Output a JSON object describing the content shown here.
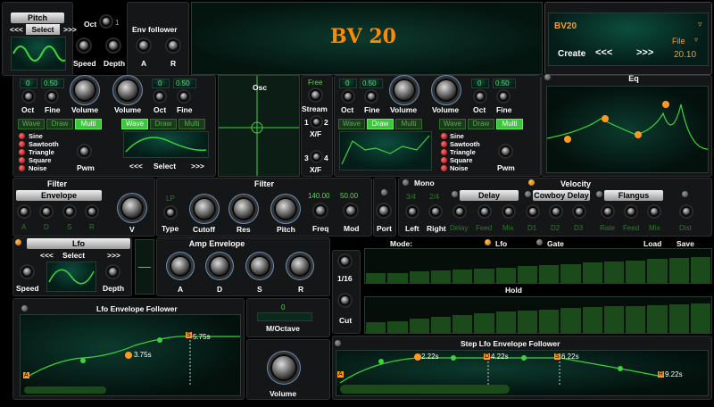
{
  "pitch": {
    "title": "Pitch",
    "prev": "<<<",
    "select": "Select",
    "next": ">>>",
    "oct_label": "Oct",
    "oct_value": "1",
    "env_follower": "Env follower",
    "speed": "Speed",
    "depth": "Depth",
    "a": "A",
    "r": "R"
  },
  "title": "BV 20",
  "preset": {
    "name": "BV20",
    "file": "File",
    "create": "Create",
    "prev": "<<<",
    "next": ">>>",
    "version": "20.10"
  },
  "osc1": {
    "oct_val": "0",
    "fine_val": "0.50",
    "oct": "Oct",
    "fine": "Fine",
    "volume": "Volume",
    "volume2": "Volume",
    "oct_val2": "0",
    "fine_val2": "0.50",
    "oct2": "Oct",
    "fine2": "Fine",
    "tabs": [
      "Wave",
      "Draw",
      "Multi"
    ],
    "tabs2": [
      "Wave",
      "Draw",
      "Multi"
    ],
    "waves": [
      "Sine",
      "Sawtooth",
      "Triangle",
      "Square",
      "Noise"
    ],
    "pwm": "Pwm",
    "prev": "<<<",
    "select": "Select",
    "next": ">>>"
  },
  "osc_center": {
    "title": "Osc",
    "free": "Free",
    "stream": "Stream",
    "n1": "1",
    "n2": "2",
    "xf1": "X/F",
    "n3": "3",
    "n4": "4",
    "xf2": "X/F"
  },
  "osc2": {
    "oct_val": "0",
    "fine_val": "0.50",
    "oct": "Oct",
    "fine": "Fine",
    "volume": "Volume",
    "volume2": "Volume",
    "oct_val2": "0",
    "fine_val2": "0.50",
    "oct2": "Oct",
    "fine2": "Fine",
    "tabs": [
      "Wave",
      "Draw",
      "Multi"
    ],
    "tabs2": [
      "Wave",
      "Draw",
      "Multi"
    ],
    "waves": [
      "Sine",
      "Sawtooth",
      "Triangle",
      "Square",
      "Noise"
    ],
    "pwm": "Pwm"
  },
  "eq": {
    "title": "Eq"
  },
  "filter_left": {
    "title": "Filter",
    "envelope": "Envelope",
    "a": "A",
    "d": "D",
    "s": "S",
    "r": "R",
    "v": "V"
  },
  "filter": {
    "title": "Filter",
    "type_val": "LP",
    "type": "Type",
    "cutoff": "Cutoff",
    "res": "Res",
    "pitch": "Pitch",
    "freq_val": "140.00",
    "freq": "Freq",
    "mod_val": "50.00",
    "mod": "Mod",
    "port": "Port"
  },
  "mono": {
    "title": "Mono",
    "v1": "3/4",
    "v2": "2/4",
    "left": "Left",
    "right": "Right"
  },
  "velocity": {
    "title": "Velocity"
  },
  "delay": {
    "title": "Delay",
    "delay": "Delay",
    "feed": "Feed",
    "mix": "Mix"
  },
  "cowboy": {
    "title": "Cowboy Delay",
    "d1": "D1",
    "d2": "D2",
    "d3": "D3"
  },
  "flangus": {
    "title": "Flangus",
    "rate": "Rate",
    "feed": "Feed",
    "mix": "Mix"
  },
  "dist": {
    "label": "Dist"
  },
  "lfo": {
    "title": "Lfo",
    "prev": "<<<",
    "select": "Select",
    "next": ">>>",
    "speed": "Speed",
    "depth": "Depth"
  },
  "amp": {
    "title": "Amp Envelope",
    "a": "A",
    "d": "D",
    "s": "S",
    "r": "R"
  },
  "mode": {
    "label": "Mode:",
    "lfo": "Lfo",
    "gate": "Gate",
    "load": "Load",
    "save": "Save",
    "rate": "1/16",
    "cut": "Cut",
    "hold": "Hold"
  },
  "lfo_env": {
    "title": "Lfo Envelope Follower",
    "t1": "3.75s",
    "t2": "5.75s",
    "m1": "A",
    "m2": "S"
  },
  "moct": {
    "value": "0",
    "label": "M/Octave"
  },
  "volume": {
    "label": "Volume"
  },
  "step_env": {
    "title": "Step Lfo Envelope Follower",
    "t1": "2.22s",
    "t2": "4.22s",
    "t3": "6.22s",
    "t4": "9.22s",
    "m1": "A",
    "m2": "D",
    "m3": "S",
    "m4": "R"
  },
  "step_bars": [
    0.28,
    0.3,
    0.33,
    0.36,
    0.4,
    0.43,
    0.46,
    0.5,
    0.53,
    0.56,
    0.6,
    0.63,
    0.66,
    0.7,
    0.73,
    0.76
  ],
  "step_bars2": [
    0.3,
    0.32,
    0.4,
    0.45,
    0.5,
    0.55,
    0.6,
    0.62,
    0.65,
    0.7,
    0.72,
    0.74,
    0.76,
    0.78,
    0.8,
    0.82
  ]
}
